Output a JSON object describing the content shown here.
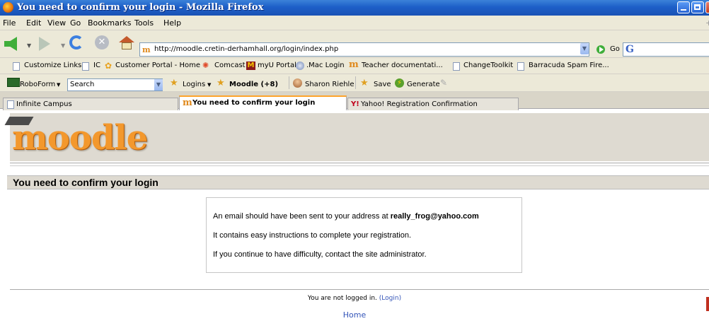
{
  "window": {
    "title": "You need to confirm your login - Mozilla Firefox"
  },
  "menu": [
    "File",
    "Edit",
    "View",
    "Go",
    "Bookmarks",
    "Tools",
    "Help"
  ],
  "navigation": {
    "url": "http://moodle.cretin-derhamhall.org/login/index.php",
    "go_label": "Go"
  },
  "bookmarks": [
    "Customize Links",
    "IC",
    "Customer Portal - Home",
    "Comcast",
    "myU Portal",
    ".Mac Login",
    "Teacher documentati...",
    "ChangeToolkit",
    "Barracuda Spam Fire..."
  ],
  "roboform": {
    "label": "RoboForm",
    "search_value": "Search",
    "logins": "Logins",
    "moodle": "Moodle (+8)",
    "user": "Sharon Riehle",
    "save": "Save",
    "generate": "Generate"
  },
  "tabs": [
    {
      "label": "Infinite Campus",
      "active": false
    },
    {
      "label": "You need to confirm your login",
      "active": true
    },
    {
      "label": "Yahoo! Registration Confirmation",
      "active": false
    }
  ],
  "page": {
    "logo": "moodle",
    "heading": "You need to confirm your login",
    "notice": {
      "line1_prefix": "An email should have been sent to your address at",
      "email": "really_frog@yahoo.com",
      "line2": "It contains easy instructions to complete your registration.",
      "line3": "If you continue to have difficulty, contact the site administrator."
    },
    "footer": {
      "not_logged_in": "You are not logged in.",
      "login_link": "(Login)",
      "home_link": "Home"
    }
  },
  "colors": {
    "moodle_orange": "#f3982d",
    "header_bg": "#dedad1",
    "link_blue": "#3354b8"
  }
}
